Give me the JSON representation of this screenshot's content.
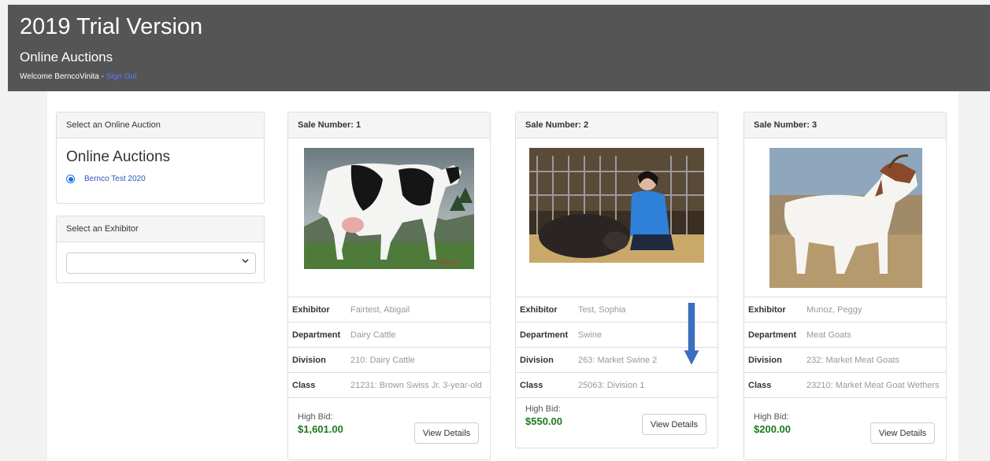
{
  "header": {
    "title": "2019 Trial Version",
    "subtitle": "Online Auctions",
    "welcome": "Welcome BerncoVinita - ",
    "sign_out": "Sign Out"
  },
  "auction_panel": {
    "heading": "Select an Online Auction",
    "title": "Online Auctions",
    "option": "Bernco Test 2020"
  },
  "exhibitor_panel": {
    "heading": "Select an Exhibitor",
    "selected": ""
  },
  "labels": {
    "exhibitor": "Exhibitor",
    "department": "Department",
    "division": "Division",
    "class": "Class",
    "high_bid": "High Bid:",
    "view_details": "View Details"
  },
  "cards": [
    {
      "sale": "Sale Number: 1",
      "image": "holstein-cow-photo",
      "exhibitor": "Fairtest, Abigail",
      "department": "Dairy Cattle",
      "division": "210: Dairy Cattle",
      "class": "21231: Brown Swiss Jr. 3-year-old",
      "high_bid": "$1,601.00"
    },
    {
      "sale": "Sale Number: 2",
      "image": "swine-with-girl-photo",
      "exhibitor": "Test, Sophia",
      "department": "Swine",
      "division": "263: Market Swine 2",
      "class": "25063: Division 1",
      "high_bid": "$550.00"
    },
    {
      "sale": "Sale Number: 3",
      "image": "meat-goat-photo",
      "exhibitor": "Munoz, Peggy",
      "department": "Meat Goats",
      "division": "232: Market Meat Goats",
      "class": "23210: Market Meat Goat Wethers",
      "high_bid": "$200.00"
    }
  ],
  "colors": {
    "header_bg": "#555555",
    "link": "#5b7bff",
    "high_bid": "#1f7a1f",
    "arrow": "#3a6fc4"
  }
}
